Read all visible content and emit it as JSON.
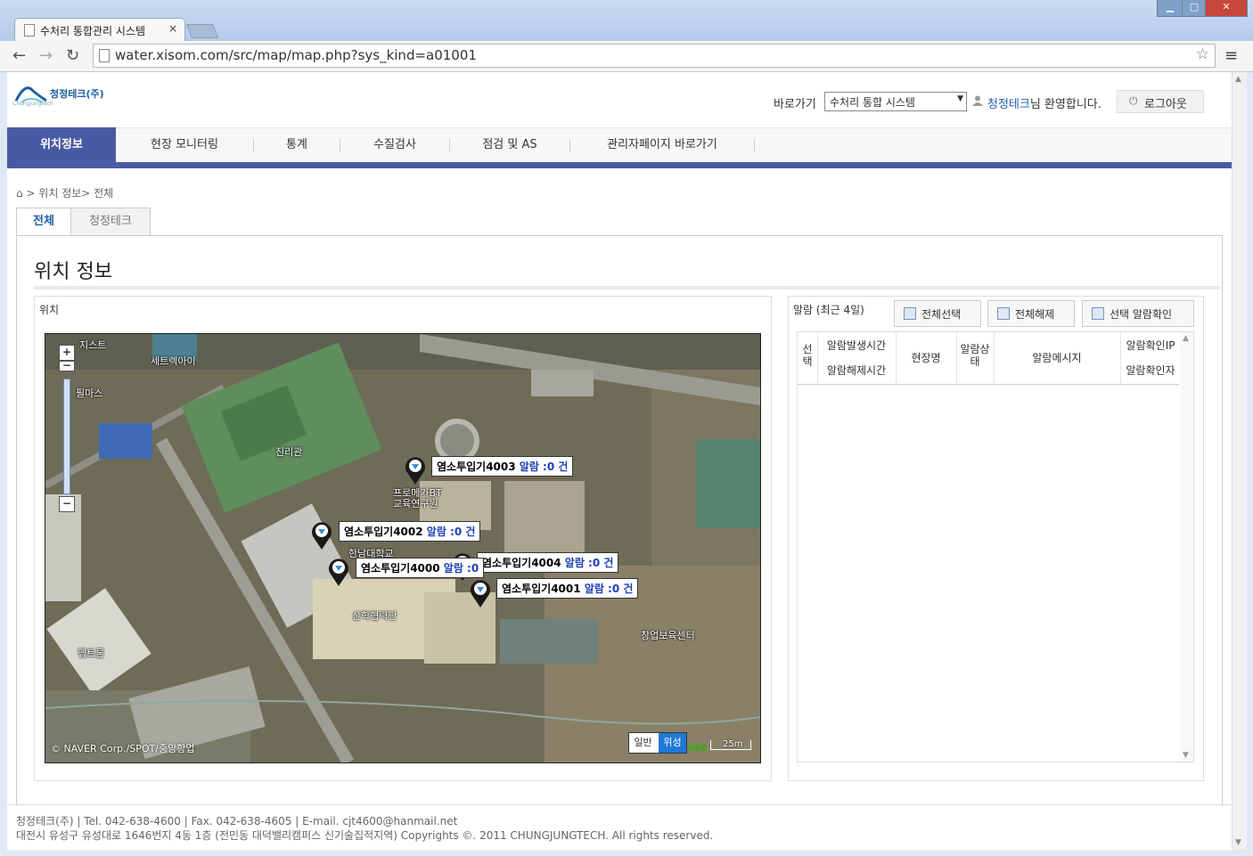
{
  "browser": {
    "tab_title": "수처리 통합관리 시스템",
    "tab_close": "×",
    "url": "water.xisom.com/src/map/map.php?sys_kind=a01001",
    "window_controls": {
      "minimize": "▁",
      "maximize": "▢",
      "close": "✕"
    }
  },
  "header": {
    "logo_text": "청정테크(주)",
    "logo_sub": "Chungjungtech",
    "goto_label": "바로가기",
    "goto_selected": "수처리 통합 시스템",
    "user_name": "청정테크",
    "welcome_suffix": "님 환영합니다.",
    "logout_label": "로그아웃",
    "icons": {
      "user": "user-icon",
      "power": "power-icon"
    }
  },
  "nav": {
    "items": [
      {
        "label": "위치정보",
        "active": true
      },
      {
        "label": "현장 모니터링",
        "active": false
      },
      {
        "label": "통계",
        "active": false
      },
      {
        "label": "수질검사",
        "active": false
      },
      {
        "label": "점검 및 AS",
        "active": false
      },
      {
        "label": "관리자페이지 바로가기",
        "active": false
      }
    ],
    "accent": "#4a5aa2"
  },
  "breadcrumb": "⌂ > 위치 정보> 전체",
  "page_tabs": [
    {
      "label": "전체",
      "active": true
    },
    {
      "label": "청정테크",
      "active": false
    }
  ],
  "page_title": "위치 정보",
  "location_panel": {
    "heading": "위치",
    "map": {
      "markers": [
        {
          "name": "염소투입기4003",
          "alarm": "알람 :0 건"
        },
        {
          "name": "염소투입기4002",
          "alarm": "알람 :0 건"
        },
        {
          "name": "염소투입기4000",
          "alarm": "알람 :0"
        },
        {
          "name": "염소투입기4004",
          "alarm": "알람 :0 건"
        },
        {
          "name": "염소투입기4001",
          "alarm": "알람 :0 건"
        }
      ],
      "places": [
        "지스트",
        "세트렉아이",
        "필마스",
        "진리관",
        "프로메가BT",
        "교육연구원",
        "한남대학교",
        "산학협력단",
        "펩트론",
        "창업보육센터"
      ],
      "zoom_in": "+",
      "zoom_out": "−",
      "map_type_normal": "일반",
      "map_type_satellite": "위성",
      "scale": "25m",
      "brand": "VER",
      "copyright": "© NAVER Corp./SPOT/중앙항업"
    }
  },
  "alarm_panel": {
    "heading": "알람 (최근 4일)",
    "buttons": {
      "select_all": "전체선택",
      "deselect_all": "전체해제",
      "confirm_selected": "선택 알람확인"
    },
    "columns": {
      "select": "선\n택",
      "occurred": "알람발생시간",
      "cleared": "알람해제시간",
      "site": "현장명",
      "status": "알람상\n태",
      "message": "알람메시지",
      "confirm_ip": "알람확인IP",
      "confirmer": "알람확인자"
    },
    "rows": []
  },
  "footer": {
    "line1": "청정테크(주) | Tel. 042-638-4600 | Fax. 042-638-4605 | E-mail. cjt4600@hanmail.net",
    "line2": "대전시 유성구 유성대로 1646번지 4동 1층 (전민동 대덕밸리캠퍼스 신기술집적지역) Copyrights ©. 2011 CHUNGJUNGTECH. All rights reserved."
  }
}
